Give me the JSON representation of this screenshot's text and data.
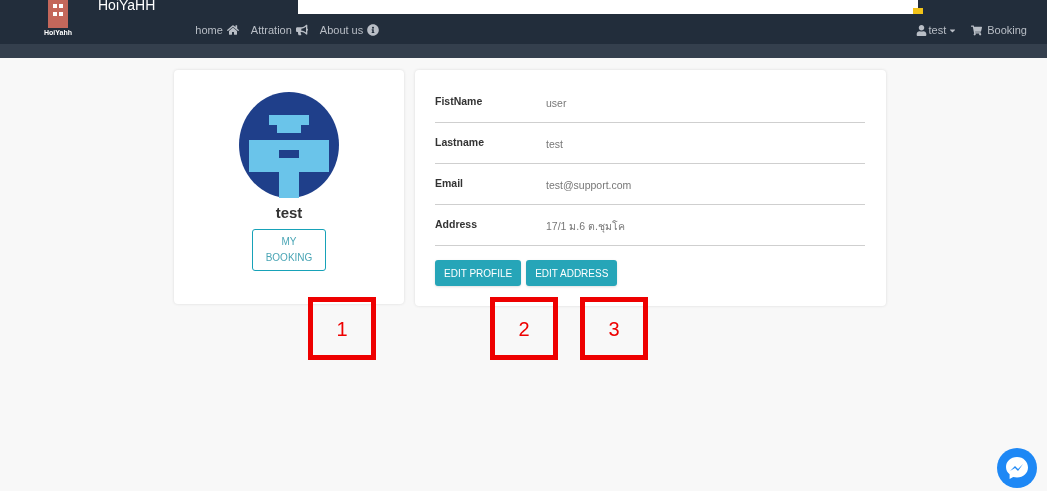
{
  "navbar": {
    "logo_caption": "HoiYahh",
    "brand": "HoiYaHH",
    "links": [
      {
        "label": "home",
        "kind": "home"
      },
      {
        "label": "Attration",
        "kind": "megaphone"
      },
      {
        "label": "About us",
        "kind": "info"
      }
    ],
    "user_menu": "test",
    "booking": "Booking"
  },
  "profile": {
    "name": "test",
    "my_booking_button": "MY BOOKING"
  },
  "details": {
    "fields": [
      {
        "label": "FistName",
        "value": "user"
      },
      {
        "label": "Lastname",
        "value": "test"
      },
      {
        "label": "Email",
        "value": "test@support.com"
      },
      {
        "label": "Address",
        "value": "17/1 ม.6 ต.ชุมโค"
      }
    ],
    "buttons": [
      "EDIT PROFILE",
      "EDIT ADDRESS"
    ]
  },
  "annotations": [
    "1",
    "2",
    "3"
  ]
}
